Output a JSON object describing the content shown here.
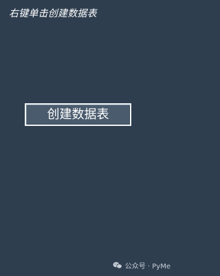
{
  "window": {
    "hint_text": "右键单击创建数据表"
  },
  "main": {
    "create_button_label": "创建数据表"
  },
  "watermark": {
    "icon": "wechat-icon",
    "text": "公众号 · PyMe"
  },
  "colors": {
    "background": "#2e3e4f",
    "button_fill": "#4a5b6d",
    "button_border": "#f3f5f7",
    "text": "#ffffff"
  }
}
